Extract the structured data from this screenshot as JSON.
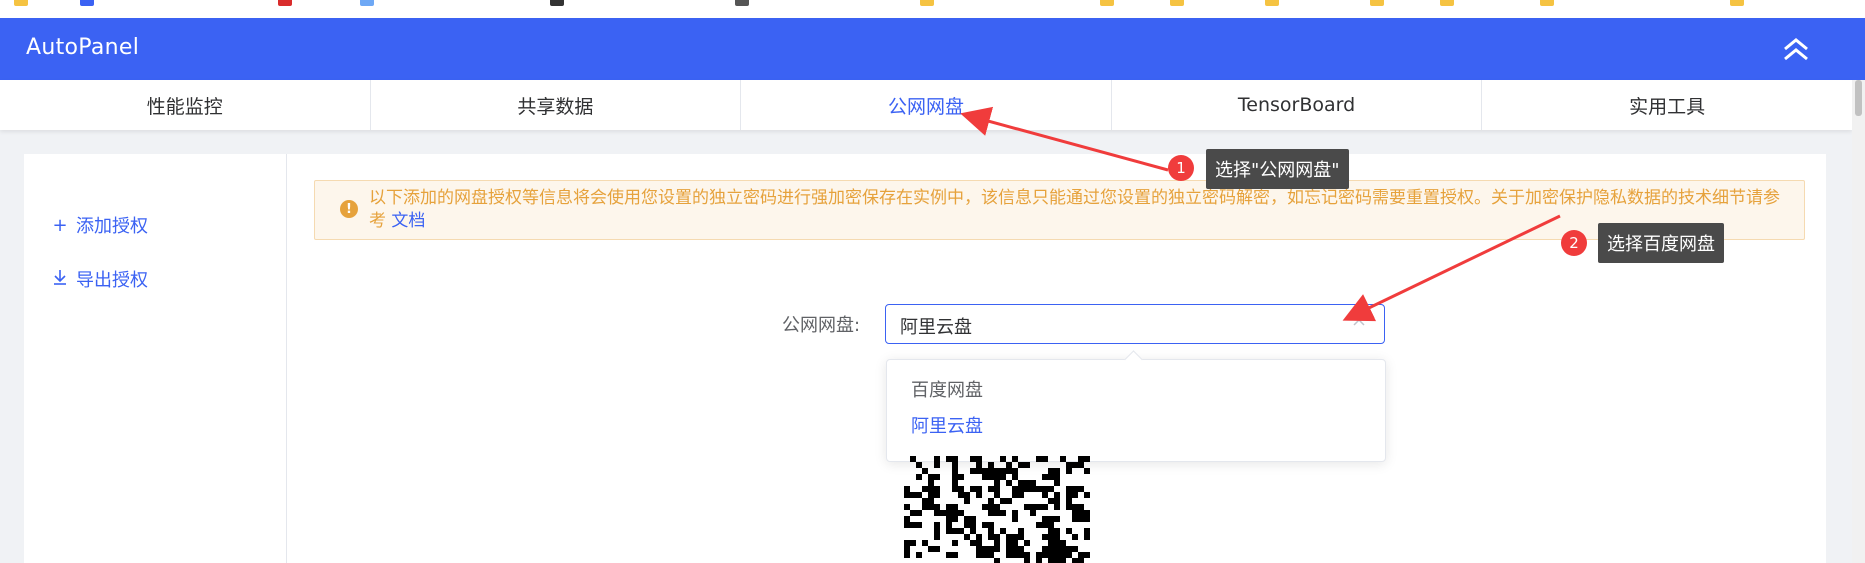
{
  "app": {
    "title": "AutoPanel"
  },
  "tabs": [
    {
      "label": "性能监控",
      "active": false
    },
    {
      "label": "共享数据",
      "active": false
    },
    {
      "label": "公网网盘",
      "active": true
    },
    {
      "label": "TensorBoard",
      "active": false
    },
    {
      "label": "实用工具",
      "active": false
    }
  ],
  "sidebar": {
    "items": [
      {
        "label": "添加授权",
        "icon": "plus-icon"
      },
      {
        "label": "导出授权",
        "icon": "download-icon"
      }
    ]
  },
  "alert": {
    "text": "以下添加的网盘授权等信息将会使用您设置的独立密码进行强加密保存在实例中，该信息只能通过您设置的独立密码解密，如忘记密码需要重置授权。关于加密保护隐私数据的技术细节请参考",
    "link": "文档"
  },
  "form": {
    "label": "公网网盘:",
    "value": "阿里云盘",
    "options": [
      {
        "label": "百度网盘",
        "selected": false
      },
      {
        "label": "阿里云盘",
        "selected": true
      }
    ]
  },
  "annotations": [
    {
      "number": "1",
      "text": "选择\"公网网盘\""
    },
    {
      "number": "2",
      "text": "选择百度网盘"
    }
  ],
  "colors": {
    "primary": "#3b62f3",
    "warning": "#e6a23c",
    "annotation_red": "#f03c3c"
  }
}
